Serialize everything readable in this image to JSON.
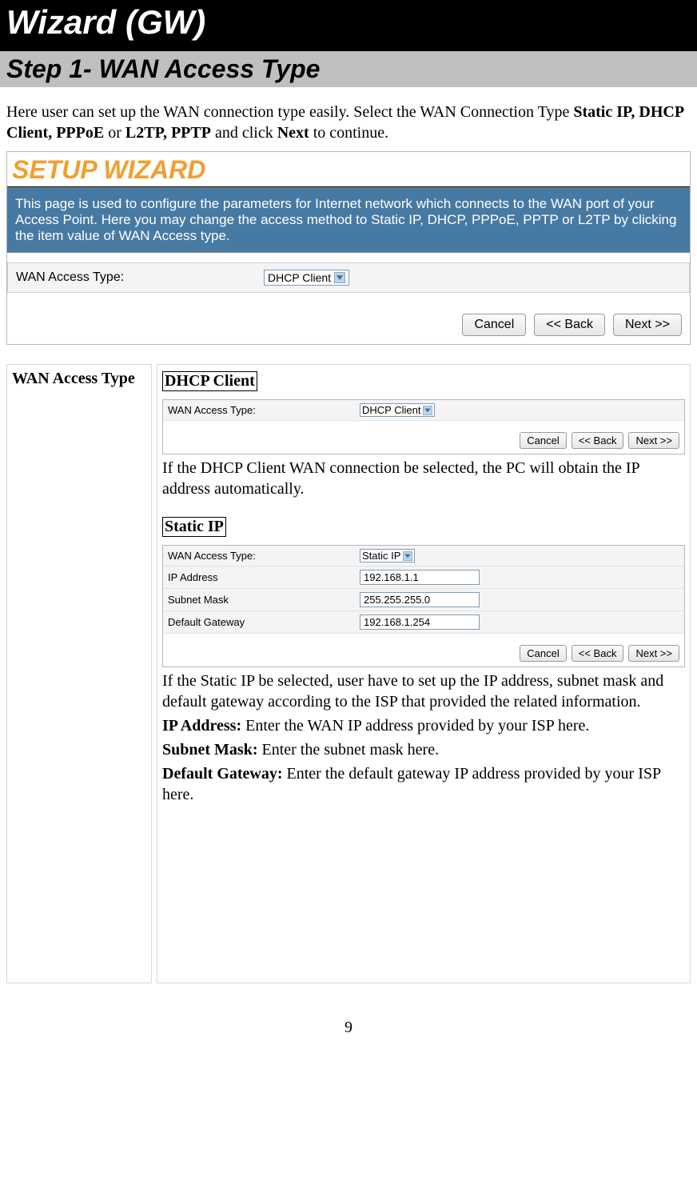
{
  "page": {
    "title": "Wizard (GW)",
    "step": "Step 1- WAN Access Type",
    "intro_1": "Here user can set up the WAN connection type easily. Select the WAN Connection Type ",
    "intro_b1": "Static IP, DHCP Client, PPPoE",
    "intro_2": " or ",
    "intro_b2": "L2TP, PPTP",
    "intro_3": " and click ",
    "intro_b3": "Next",
    "intro_4": " to continue.",
    "page_number": "9"
  },
  "wizard": {
    "heading": "SETUP WIZARD",
    "desc": "This page is used to configure the parameters for Internet network which connects to the WAN port of your Access Point. Here you may change the access method to Static IP, DHCP, PPPoE, PPTP or L2TP by clicking the item value of WAN Access type.",
    "wan_label": "WAN Access Type:",
    "wan_value": "DHCP Client",
    "btn_cancel": "Cancel",
    "btn_back": "<< Back",
    "btn_next": "Next >>"
  },
  "table": {
    "left_label": "WAN Access Type",
    "dhcp": {
      "heading": "DHCP Client",
      "wan_label": "WAN Access Type:",
      "wan_value": "DHCP Client",
      "btn_cancel": "Cancel",
      "btn_back": "<< Back",
      "btn_next": "Next >>",
      "text": "If the DHCP Client WAN connection be selected, the PC will obtain the IP address automatically."
    },
    "static": {
      "heading": "Static IP",
      "wan_label": "WAN Access Type:",
      "wan_value": "Static IP",
      "ip_label": "IP Address",
      "ip_value": "192.168.1.1",
      "mask_label": "Subnet Mask",
      "mask_value": "255.255.255.0",
      "gw_label": "Default Gateway",
      "gw_value": "192.168.1.254",
      "btn_cancel": "Cancel",
      "btn_back": "<< Back",
      "btn_next": "Next >>",
      "text": "If the Static IP be selected, user have to set up the IP address, subnet mask and default gateway according to the ISP that provided the related information.",
      "ip_b": "IP Address:",
      "ip_t": " Enter the WAN IP address provided by your ISP here.",
      "mask_b": "Subnet Mask:",
      "mask_t": " Enter the subnet mask here.",
      "gw_b": "Default Gateway:",
      "gw_t": " Enter the default gateway IP address provided by your ISP here."
    }
  }
}
